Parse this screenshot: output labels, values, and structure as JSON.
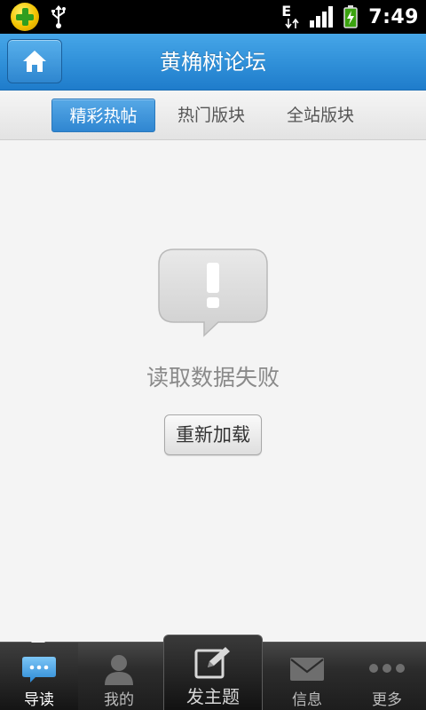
{
  "status_bar": {
    "network_type": "E",
    "time": "7:49",
    "icons": [
      "app-notification-icon",
      "usb-icon",
      "network-arrows-icon",
      "signal-strength-icon",
      "battery-charging-icon"
    ]
  },
  "header": {
    "title": "黄桷树论坛",
    "home_icon": "home-icon"
  },
  "tabs": [
    {
      "label": "精彩热帖",
      "active": true
    },
    {
      "label": "热门版块",
      "active": false
    },
    {
      "label": "全站版块",
      "active": false
    }
  ],
  "content": {
    "icon": "warning-bubble-icon",
    "error_message": "读取数据失败",
    "reload_label": "重新加载"
  },
  "bottom_nav": {
    "items": [
      {
        "label": "导读",
        "icon": "chat-bubble-icon",
        "active": true
      },
      {
        "label": "我的",
        "icon": "user-icon",
        "active": false
      },
      {
        "label": "发主题",
        "icon": "compose-icon",
        "active": false
      },
      {
        "label": "信息",
        "icon": "envelope-icon",
        "active": false
      },
      {
        "label": "更多",
        "icon": "more-dots-icon",
        "active": false
      }
    ]
  },
  "colors": {
    "header_blue": "#2f8fd8",
    "active_tab_blue": "#3a90d6",
    "content_background": "#f4f4f4",
    "nav_background": "#2a2a2a",
    "error_text": "#8a8a8a"
  }
}
